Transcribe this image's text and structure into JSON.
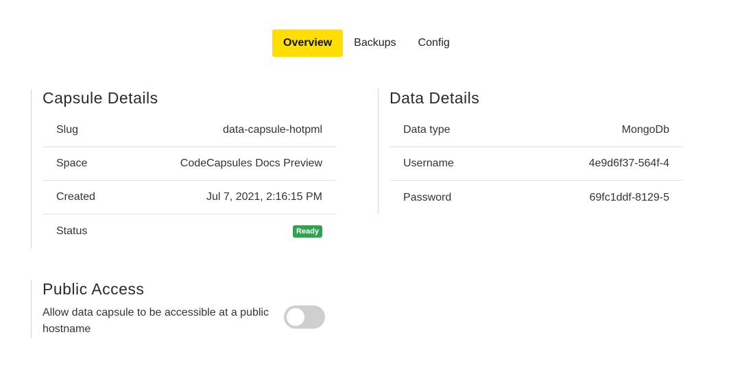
{
  "tabs": [
    {
      "label": "Overview",
      "active": true
    },
    {
      "label": "Backups",
      "active": false
    },
    {
      "label": "Config",
      "active": false
    }
  ],
  "capsule_details": {
    "title": "Capsule Details",
    "rows": [
      {
        "label": "Slug",
        "value": "data-capsule-hotpml"
      },
      {
        "label": "Space",
        "value": "CodeCapsules Docs Preview"
      },
      {
        "label": "Created",
        "value": "Jul 7, 2021, 2:16:15 PM"
      },
      {
        "label": "Status",
        "value": "Ready"
      }
    ]
  },
  "data_details": {
    "title": "Data Details",
    "rows": [
      {
        "label": "Data type",
        "value": "MongoDb"
      },
      {
        "label": "Username",
        "value": "4e9d6f37-564f-4"
      },
      {
        "label": "Password",
        "value": "69fc1ddf-8129-5"
      }
    ]
  },
  "public_access": {
    "title": "Public Access",
    "description": "Allow data capsule to be accessible at a public hostname",
    "enabled": false
  },
  "colors": {
    "accent": "#ffde00",
    "status_ready": "#2da44e",
    "toggle_off": "#cfcfcf"
  }
}
